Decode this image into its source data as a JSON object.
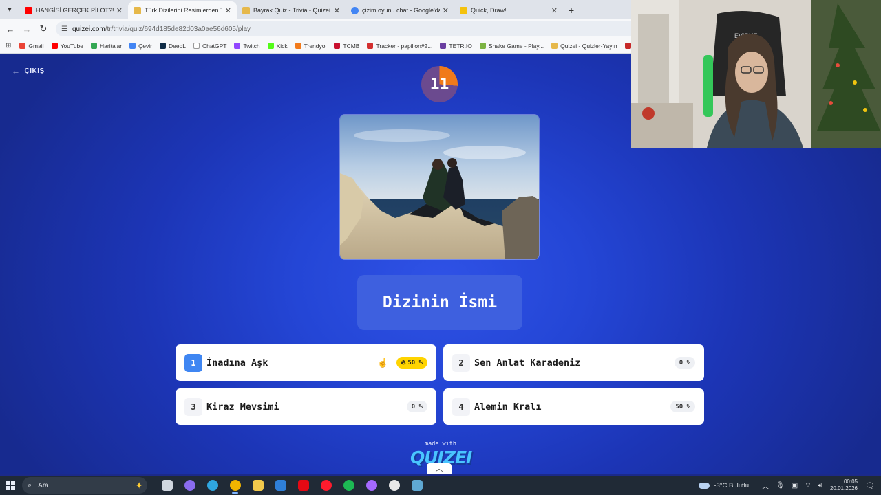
{
  "browser": {
    "tabs": [
      {
        "title": "HANGİSİ GERÇEK PİLOT?! ft. @...",
        "fav_color": "#ff0000",
        "active": false
      },
      {
        "title": "Türk Dizilerini Resimlerden Tah...",
        "fav_color": "#e6b84a",
        "active": true
      },
      {
        "title": "Bayrak Quiz - Trivia - Quizei",
        "fav_color": "#e6b84a",
        "active": false
      },
      {
        "title": "çizim oyunu chat - Google'da A...",
        "fav_color": "#4285f4",
        "active": false
      },
      {
        "title": "Quick, Draw!",
        "fav_color": "#f4c20d",
        "active": false
      }
    ],
    "url_host": "quizei.com",
    "url_path": "/tr/trivia/quiz/694d185de82d03a0ae56d605/play",
    "bookmarks": [
      {
        "label": "Gmail",
        "color": "#ea4335"
      },
      {
        "label": "YouTube",
        "color": "#ff0000"
      },
      {
        "label": "Haritalar",
        "color": "#34a853"
      },
      {
        "label": "Çevir",
        "color": "#4285f4"
      },
      {
        "label": "DeepL",
        "color": "#0f2b46"
      },
      {
        "label": "ChatGPT",
        "color": "#ffffff"
      },
      {
        "label": "Twitch",
        "color": "#9146ff"
      },
      {
        "label": "Kick",
        "color": "#53fc18"
      },
      {
        "label": "Trendyol",
        "color": "#f27a1a"
      },
      {
        "label": "TCMB",
        "color": "#c8102e"
      },
      {
        "label": "Tracker - papillon#2...",
        "color": "#d32f2f"
      },
      {
        "label": "TETR.IO",
        "color": "#6a3ea1"
      },
      {
        "label": "Snake Game - Play...",
        "color": "#7cb342"
      },
      {
        "label": "Quizei - Quizler-Yayın",
        "color": "#e6b84a"
      },
      {
        "label": "Va",
        "color": "#c62828"
      }
    ]
  },
  "quiz": {
    "exit_label": "ÇIKIŞ",
    "timer": "11",
    "question": "Dizinin İsmi",
    "answers": [
      {
        "num": "1",
        "label": "İnadına Aşk",
        "percent": "50 %",
        "selected": true,
        "hot": true
      },
      {
        "num": "2",
        "label": "Sen Anlat Karadeniz",
        "percent": "0 %",
        "selected": false,
        "hot": false
      },
      {
        "num": "3",
        "label": "Kiraz Mevsimi",
        "percent": "0 %",
        "selected": false,
        "hot": false
      },
      {
        "num": "4",
        "label": "Alemin Kralı",
        "percent": "50 %",
        "selected": false,
        "hot": false
      }
    ],
    "made_with": "made with",
    "brand": "QUIZEI"
  },
  "taskbar": {
    "search_placeholder": "Ara",
    "weather": "-3°C  Bulutlu",
    "time": "00:05",
    "date": "20.01.2026",
    "apps": [
      {
        "name": "task-view-icon",
        "color": "#cfd6df"
      },
      {
        "name": "copilot-icon",
        "color": "#8a6cf0"
      },
      {
        "name": "edge-icon",
        "color": "#2fa6e0"
      },
      {
        "name": "chrome-icon",
        "color": "#f0b400"
      },
      {
        "name": "file-explorer-icon",
        "color": "#f2c94c"
      },
      {
        "name": "mail-icon",
        "color": "#2f7fd8"
      },
      {
        "name": "netflix-icon",
        "color": "#e50914"
      },
      {
        "name": "opera-icon",
        "color": "#ff1b2d"
      },
      {
        "name": "spotify-icon",
        "color": "#1db954"
      },
      {
        "name": "obs-icon",
        "color": "#a569ff"
      },
      {
        "name": "github-desktop-icon",
        "color": "#e8e8e8"
      },
      {
        "name": "steam-icon",
        "color": "#5fa8d3"
      }
    ]
  }
}
